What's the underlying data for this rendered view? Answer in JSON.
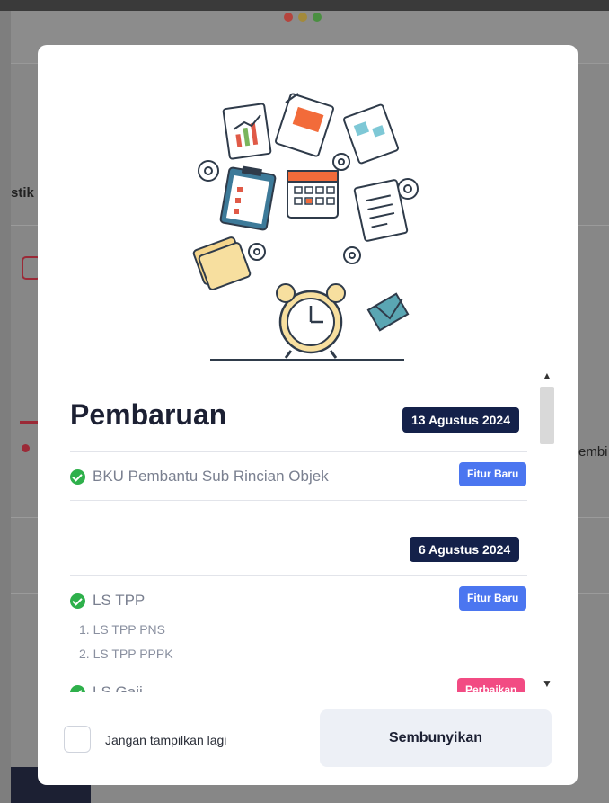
{
  "background": {
    "partial_text_left": "stik",
    "partial_text_right": "embi"
  },
  "modal": {
    "title": "Pembaruan",
    "updates": [
      {
        "date": "13 Agustus 2024",
        "items": [
          {
            "label": "BKU Pembantu Sub Rincian Objek",
            "tag": "Fitur Baru",
            "tag_color": "#4b76f0"
          }
        ]
      },
      {
        "date": "6 Agustus 2024",
        "items": [
          {
            "label": "LS TPP",
            "tag": "Fitur Baru",
            "tag_color": "#4b76f0",
            "subitems": [
              "1. LS TPP PNS",
              "2. LS TPP PPPK"
            ]
          },
          {
            "label": "LS Gaji",
            "tag": "Perbaikan",
            "tag_color": "#f24b83"
          }
        ]
      }
    ],
    "footer": {
      "checkbox_label": "Jangan tampilkan lagi",
      "checkbox_checked": false,
      "hide_button_label": "Sembunyikan"
    },
    "colors": {
      "accent_navy": "#14214a",
      "success_green": "#2eb04b"
    }
  }
}
